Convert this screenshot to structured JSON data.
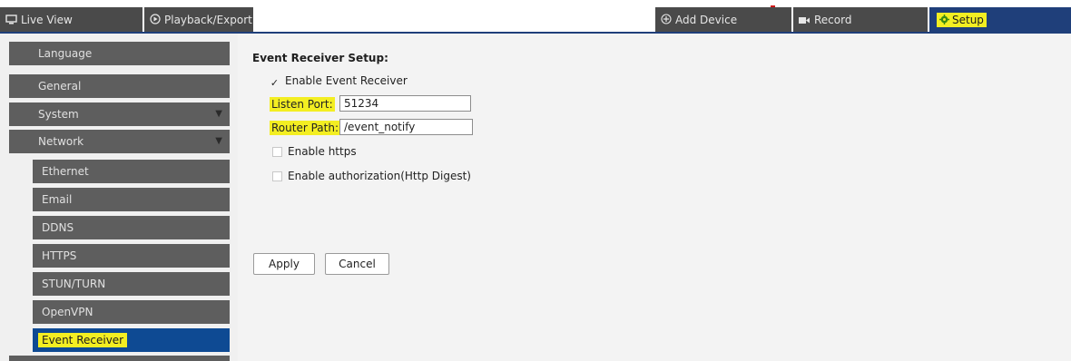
{
  "topbar": {
    "tabs": [
      {
        "label": "Live View",
        "icon": "monitor-icon"
      },
      {
        "label": "Playback/Export",
        "icon": "play-circle-icon"
      },
      {
        "label": "Add Device",
        "icon": "plus-circle-icon"
      },
      {
        "label": "Record",
        "icon": "camera-icon"
      },
      {
        "label": "Setup",
        "icon": "gear-icon"
      }
    ],
    "accent_color": "#1f3f7a",
    "tab_color": "#4a4a4a",
    "highlight_color": "#f3ee22"
  },
  "sidebar": {
    "items": [
      {
        "label": "Language"
      },
      {
        "label": "General"
      },
      {
        "label": "System",
        "arrow": "▼"
      },
      {
        "label": "Network",
        "arrow": "▼"
      }
    ],
    "network_items": [
      {
        "label": "Ethernet"
      },
      {
        "label": "Email"
      },
      {
        "label": "DDNS"
      },
      {
        "label": "HTTPS"
      },
      {
        "label": "STUN/TURN"
      },
      {
        "label": "OpenVPN"
      },
      {
        "label": "Event Receiver",
        "active": true
      }
    ],
    "active_color": "#0e4a93"
  },
  "main": {
    "title": "Event Receiver Setup:",
    "enable_event_receiver": {
      "label": "Enable Event Receiver",
      "checked": true,
      "mark": "✓"
    },
    "listen_port": {
      "label": "Listen Port:",
      "value": "51234"
    },
    "router_path": {
      "label": "Router Path:",
      "value": "/event_notify"
    },
    "enable_https": {
      "label": "Enable https",
      "checked": false
    },
    "enable_auth": {
      "label": "Enable authorization(Http Digest)",
      "checked": false
    },
    "apply_label": "Apply",
    "cancel_label": "Cancel"
  }
}
